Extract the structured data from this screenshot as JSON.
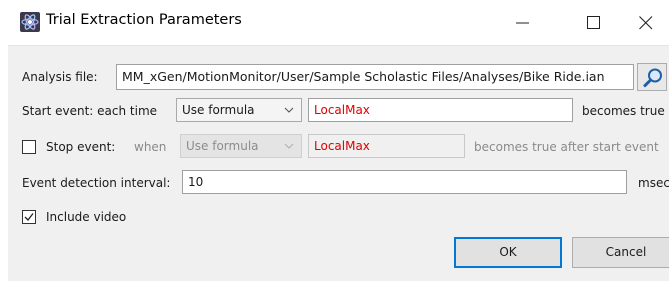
{
  "window": {
    "title": "Trial Extraction Parameters",
    "icon": "motion-monitor-app-icon",
    "controls": [
      "minimize-icon",
      "maximize-icon",
      "close-icon"
    ]
  },
  "analysis_file": {
    "label": "Analysis file:",
    "value": "MM_xGen/MotionMonitor/User/Sample Scholastic Files/Analyses/Bike Ride.ian",
    "browse_icon": "magnifier-icon"
  },
  "start_event": {
    "label": "Start event: each time",
    "mode": "Use formula",
    "formula": "LocalMax",
    "suffix": "becomes true"
  },
  "stop_event": {
    "checked": false,
    "label": "Stop event:",
    "when_label": "when",
    "mode": "Use formula",
    "formula": "LocalMax",
    "suffix": "becomes true after start event"
  },
  "event_interval": {
    "label": "Event detection interval:",
    "value": "10",
    "unit": "msec"
  },
  "include_video": {
    "checked": true,
    "label": "Include video"
  },
  "buttons": {
    "ok": "OK",
    "cancel": "Cancel"
  },
  "colors": {
    "formula_text": "#e00000",
    "default_button_border": "#0078d7"
  }
}
